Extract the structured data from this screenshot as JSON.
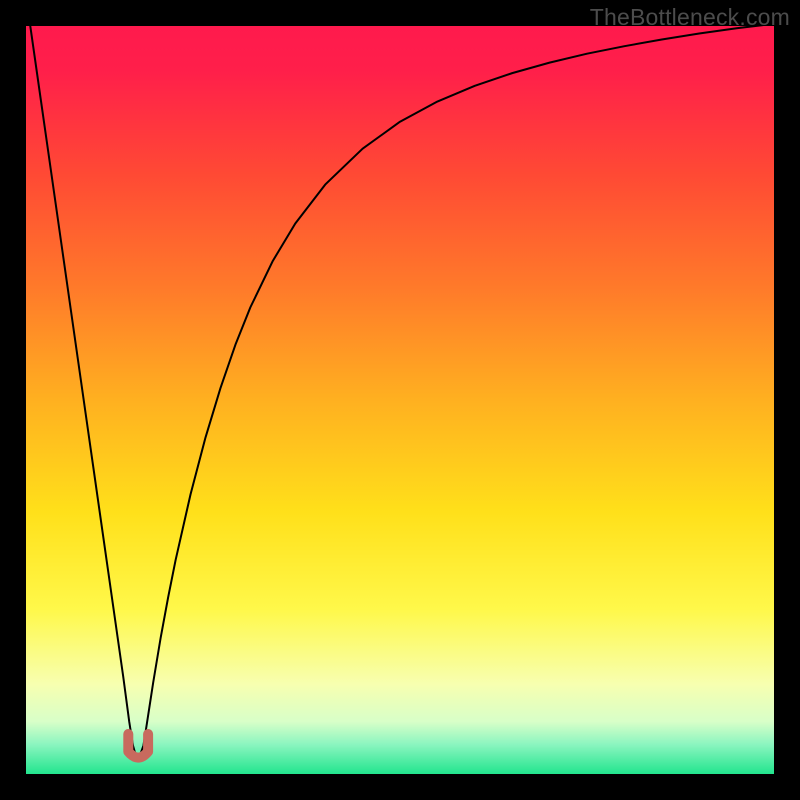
{
  "watermark": "TheBottleneck.com",
  "chart_data": {
    "type": "line",
    "title": "",
    "xlabel": "",
    "ylabel": "",
    "xlim": [
      0,
      100
    ],
    "ylim": [
      0,
      100
    ],
    "grid": false,
    "legend": false,
    "background_gradient_stops": [
      {
        "pos": 0.0,
        "color": "#ff1a4d"
      },
      {
        "pos": 0.06,
        "color": "#ff1f4a"
      },
      {
        "pos": 0.2,
        "color": "#ff4a34"
      },
      {
        "pos": 0.35,
        "color": "#ff7a2a"
      },
      {
        "pos": 0.5,
        "color": "#ffb020"
      },
      {
        "pos": 0.65,
        "color": "#ffe01a"
      },
      {
        "pos": 0.78,
        "color": "#fff84a"
      },
      {
        "pos": 0.88,
        "color": "#f7ffb0"
      },
      {
        "pos": 0.93,
        "color": "#d8ffc8"
      },
      {
        "pos": 0.96,
        "color": "#8cf5c0"
      },
      {
        "pos": 1.0,
        "color": "#22e58e"
      }
    ],
    "series": [
      {
        "name": "bottleneck-curve",
        "stroke": "#000000",
        "stroke_width": 2,
        "x": [
          0,
          1,
          2,
          3,
          4,
          5,
          6,
          7,
          8,
          9,
          10,
          11,
          12,
          13,
          13.8,
          14.3,
          14.7,
          14.9,
          15.2,
          15.7,
          16.2,
          17,
          18,
          19,
          20,
          22,
          24,
          26,
          28,
          30,
          33,
          36,
          40,
          45,
          50,
          55,
          60,
          65,
          70,
          75,
          80,
          85,
          90,
          95,
          100
        ],
        "y": [
          104,
          97,
          90,
          83,
          76,
          69,
          62,
          55,
          48,
          41,
          34,
          27,
          20,
          13,
          7,
          3.8,
          2.4,
          2.2,
          2.4,
          3.8,
          7,
          12.2,
          18.2,
          23.6,
          28.6,
          37.4,
          45.0,
          51.6,
          57.4,
          62.4,
          68.6,
          73.6,
          78.8,
          83.6,
          87.2,
          89.9,
          92.0,
          93.7,
          95.1,
          96.3,
          97.3,
          98.2,
          99.0,
          99.7,
          100.3
        ]
      }
    ],
    "marker": {
      "name": "cusp-marker",
      "color": "#c86a5e",
      "shape": "u",
      "x": 15.0,
      "y": 3.0,
      "size": 22
    }
  }
}
